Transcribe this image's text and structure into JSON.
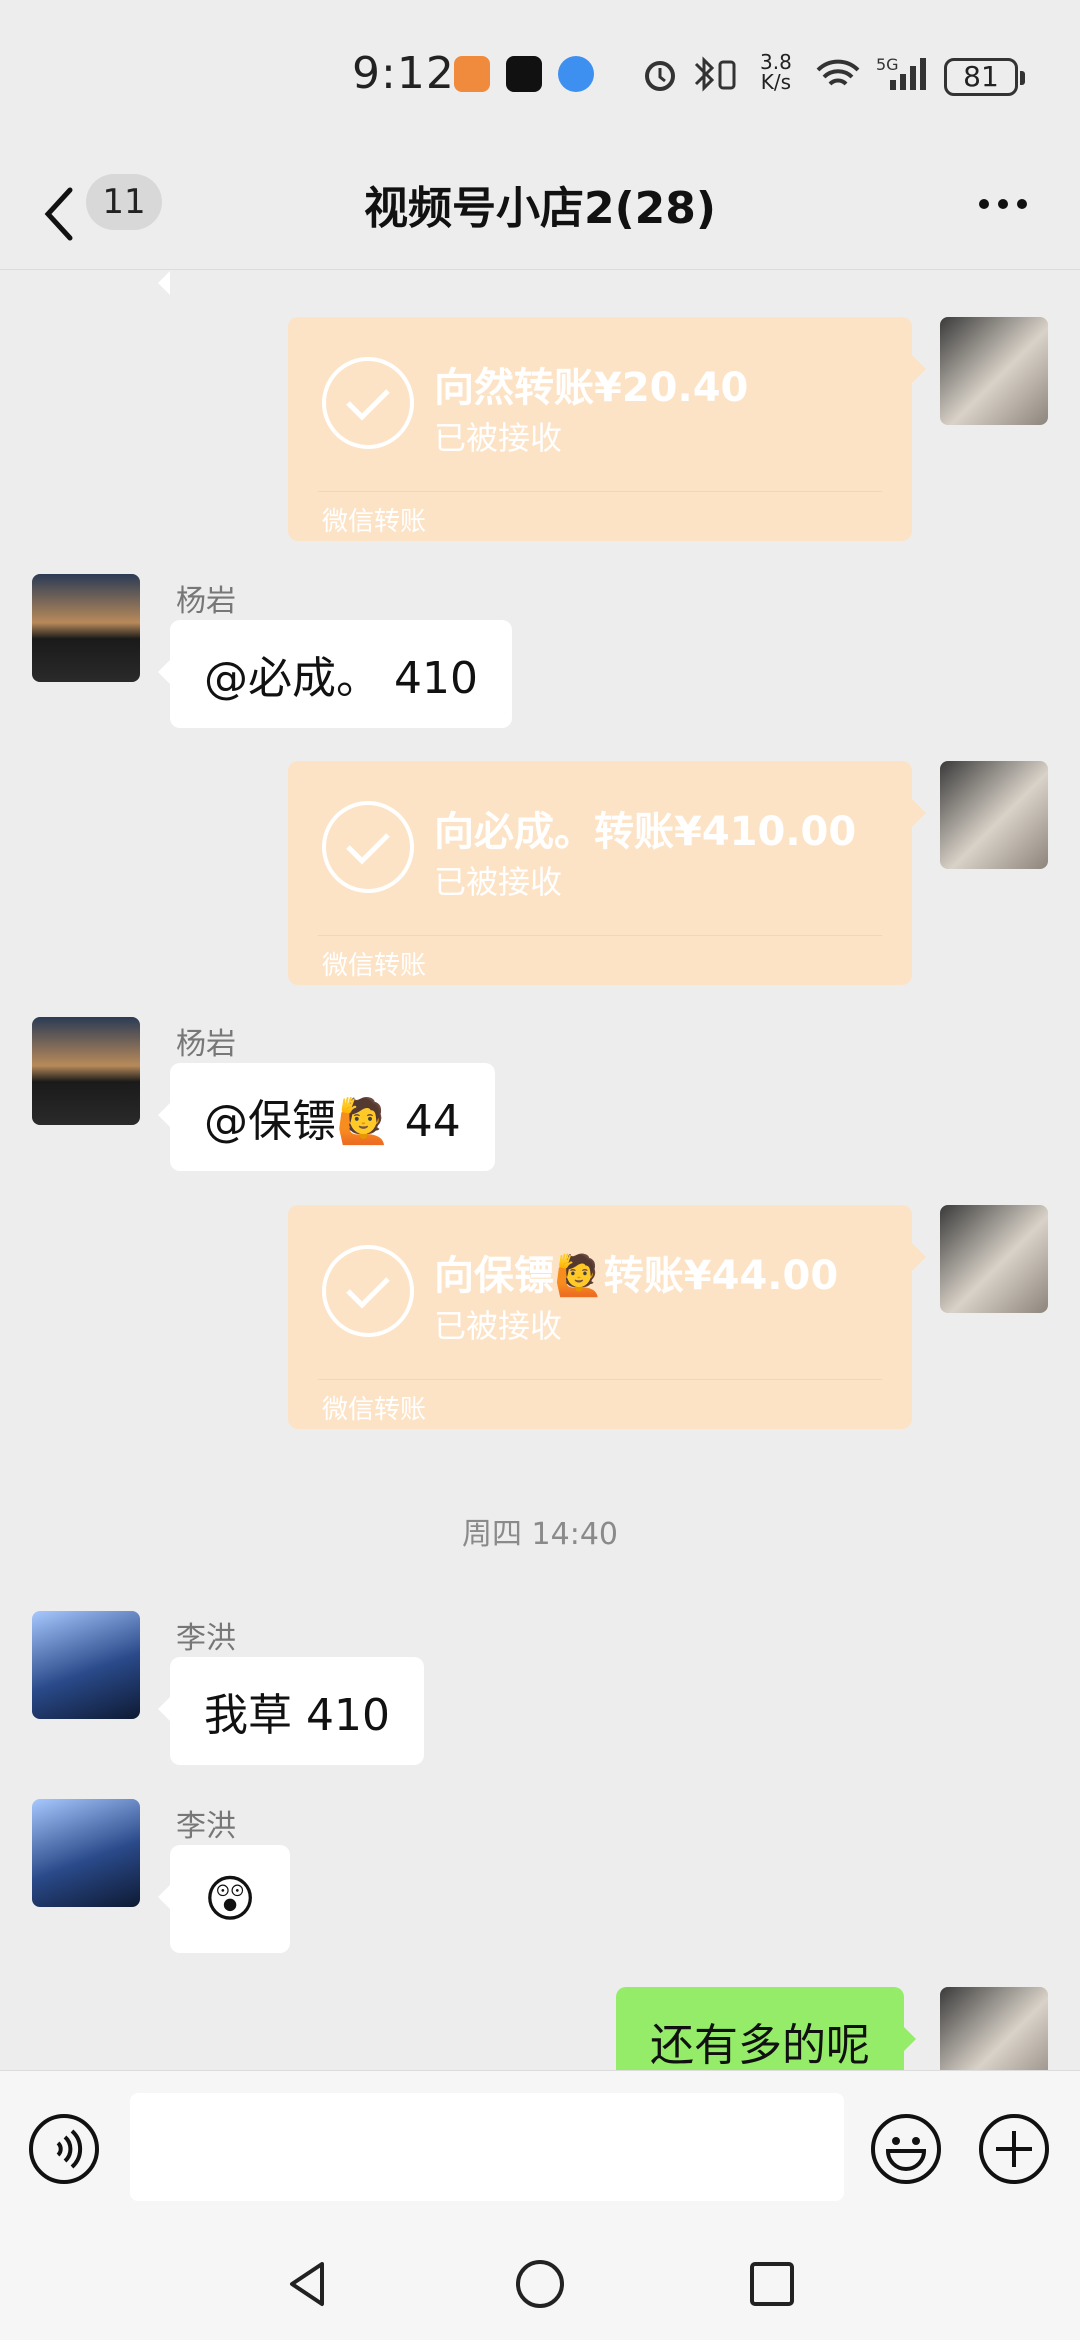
{
  "status_bar": {
    "time": "9:12",
    "speed_value": "3.8",
    "speed_unit": "K/s",
    "network": "5G",
    "battery": "81"
  },
  "header": {
    "unread_count": "11",
    "title": "视频号小店2(28)"
  },
  "messages": {
    "t1": {
      "text": "向然转账¥20.40",
      "status": "已被接收",
      "footer": "微信转账"
    },
    "m1": {
      "sender": "杨岩",
      "text": "@必成。 410"
    },
    "t2": {
      "text": "向必成。转账¥410.00",
      "status": "已被接收",
      "footer": "微信转账"
    },
    "m2": {
      "sender": "杨岩",
      "text": "@保镖🙋 44"
    },
    "t3": {
      "text": "向保镖🙋转账¥44.00",
      "status": "已被接收",
      "footer": "微信转账"
    },
    "timestamp": "周四 14:40",
    "m3": {
      "sender": "李洪",
      "text": "我草 410"
    },
    "m4": {
      "sender": "李洪",
      "text": "😲"
    },
    "m5": {
      "text": "还有多的呢"
    }
  },
  "input": {
    "placeholder": ""
  },
  "icons": {
    "voice": "voice-icon",
    "emoji": "emoji-icon",
    "plus": "plus-icon",
    "back": "back-icon",
    "more": "more-icon"
  },
  "colors": {
    "transfer": "#fde3c6",
    "self_bubble": "#95ec69",
    "background": "#ededed"
  }
}
